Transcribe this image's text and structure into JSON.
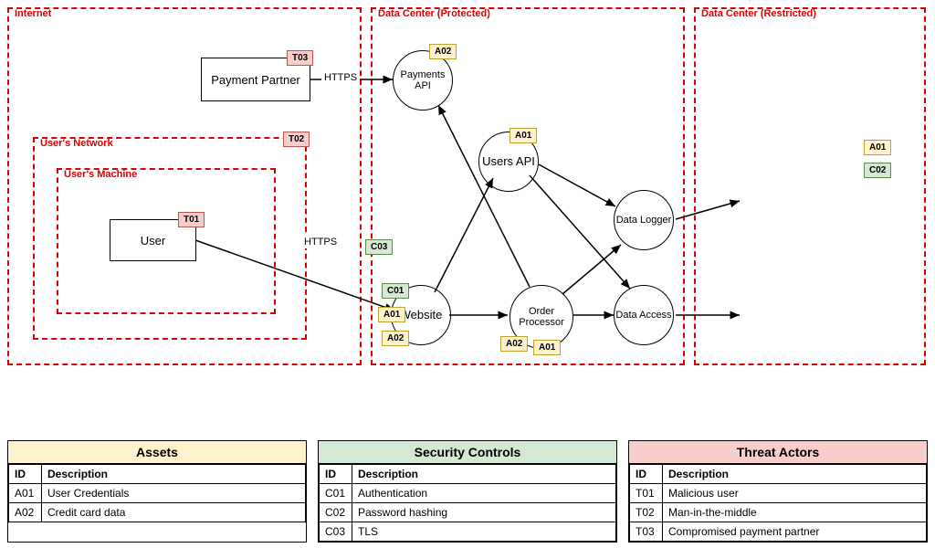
{
  "boundaries": {
    "internet": "Internet",
    "users_network": "User's Network",
    "users_machine": "User's Machine",
    "dc_protected": "Data Center (Protected)",
    "dc_restricted": "Data Center (Restricted)"
  },
  "nodes": {
    "payment_partner": "Payment Partner",
    "user": "User",
    "payments_api": "Payments API",
    "users_api": "Users API",
    "website": "Website",
    "order_processor": "Order Processor",
    "data_logger": "Data Logger",
    "data_access": "Data Access"
  },
  "edge_labels": {
    "user_website": "HTTPS",
    "partner_payments": "HTTPS"
  },
  "tags": {
    "A01": "A01",
    "A02": "A02",
    "C01": "C01",
    "C02": "C02",
    "C03": "C03",
    "T01": "T01",
    "T02": "T02",
    "T03": "T03"
  },
  "legend": {
    "assets": {
      "title": "Assets",
      "id_header": "ID",
      "desc_header": "Description",
      "rows": [
        {
          "id": "A01",
          "desc": "User Credentials"
        },
        {
          "id": "A02",
          "desc": "Credit card data"
        }
      ]
    },
    "controls": {
      "title": "Security Controls",
      "id_header": "ID",
      "desc_header": "Description",
      "rows": [
        {
          "id": "C01",
          "desc": "Authentication"
        },
        {
          "id": "C02",
          "desc": "Password hashing"
        },
        {
          "id": "C03",
          "desc": "TLS"
        }
      ]
    },
    "threats": {
      "title": "Threat Actors",
      "id_header": "ID",
      "desc_header": "Description",
      "rows": [
        {
          "id": "T01",
          "desc": "Malicious user"
        },
        {
          "id": "T02",
          "desc": "Man-in-the-middle"
        },
        {
          "id": "T03",
          "desc": "Compromised payment partner"
        }
      ]
    }
  }
}
